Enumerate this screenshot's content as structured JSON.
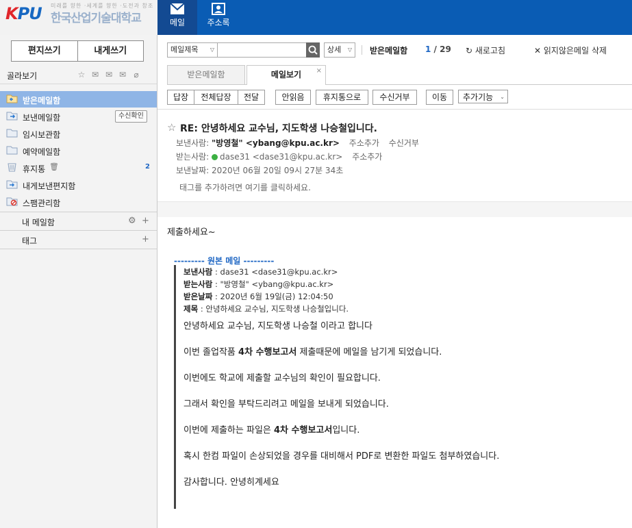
{
  "header": {
    "logo_k": "K",
    "logo_pu": "PU",
    "logo_sub": "미래를 향한 ·세계를 향한 ·도전과 창조",
    "logo_name": "한국산업기술대학교",
    "nav": [
      {
        "label": "메일",
        "icon": "mail-icon"
      },
      {
        "label": "주소록",
        "icon": "contacts-icon"
      }
    ]
  },
  "sidebar": {
    "compose": "편지쓰기",
    "compose_self": "내게쓰기",
    "pick_label": "골라보기",
    "pick_icons": [
      "star-icon",
      "mail-icon",
      "mail-open-icon",
      "mail-me-icon",
      "attach-icon"
    ],
    "folders": [
      {
        "name": "받은메일함",
        "icon": "inbox-folder-icon"
      },
      {
        "name": "보낸메일함",
        "icon": "sent-folder-icon",
        "badge": "수신확인"
      },
      {
        "name": "임시보관함",
        "icon": "draft-folder-icon"
      },
      {
        "name": "예약메일함",
        "icon": "reserved-folder-icon"
      },
      {
        "name": "휴지통",
        "icon": "trash-icon",
        "count": "2"
      },
      {
        "name": "내게보낸편지함",
        "icon": "self-folder-icon"
      },
      {
        "name": "스팸관리함",
        "icon": "spam-folder-icon"
      }
    ],
    "my_mailbox": "내 메일함",
    "tags": "태그"
  },
  "main": {
    "search": {
      "field": "메일제목",
      "detail": "상세"
    },
    "mailbox_title": "받은메일함",
    "page_current": "1",
    "page_sep": " / ",
    "page_total": "29",
    "refresh": "새로고침",
    "delete_unread": "읽지않은메일 삭제",
    "tabs": [
      {
        "label": "받은메일함"
      },
      {
        "label": "메일보기",
        "close": "×"
      }
    ],
    "toolbar": {
      "reply": "답장",
      "reply_all": "전체답장",
      "forward": "전달",
      "mark_unread": "안읽음",
      "to_trash": "휴지통으로",
      "block": "수신거부",
      "move": "이동",
      "more": "추가기능"
    }
  },
  "message": {
    "subject": "RE: 안녕하세요 교수님, 지도학생 나승철입니다.",
    "from_label": "보낸사람:",
    "from_value": "\"방영철\" <ybang@kpu.ac.kr>",
    "add_contact": "주소추가",
    "block": "수신거부",
    "to_label": "받는사람:",
    "to_value": "dase31 <dase31@kpu.ac.kr>",
    "date_label": "보낸날짜:",
    "date_value": "2020년 06월 20일 09시 27분 34초",
    "tag_hint": "태그를 추가하려면 여기를 클릭하세요.",
    "body": "제출하세요~",
    "original": {
      "separator": "--------- 원본 메일 ---------",
      "from_label": "보낸사람",
      "from_value": ": dase31 <dase31@kpu.ac.kr>",
      "to_label": "받는사람",
      "to_value": ": \"방영철\" <ybang@kpu.ac.kr>",
      "date_label": "받은날짜",
      "date_value": ": 2020년 6월 19일(금) 12:04:50",
      "subject_label": "제목",
      "subject_value": ": 안녕하세요 교수님, 지도학생 나승철입니다.",
      "paragraphs": [
        {
          "text": "안녕하세요 교수님, 지도학생 나승철 이라고 합니다"
        },
        {
          "pre": "이번 졸업작품 ",
          "bold": "4차 수행보고서",
          "post": " 제출때문에 메일을 남기게 되었습니다."
        },
        {
          "text": "이번에도 학교에 제출할 교수님의 확인이 필요합니다."
        },
        {
          "text": "그래서 확인을 부탁드리려고 메일을 보내게 되었습니다."
        },
        {
          "pre": "이번에 제출하는 파일은 ",
          "bold": "4차 수행보고서",
          "post": "입니다."
        },
        {
          "text": "혹시 한컴 파일이 손상되었을 경우를 대비해서 PDF로 변환한 파일도 첨부하였습니다."
        },
        {
          "text": "감사합니다. 안녕히계세요"
        }
      ]
    }
  },
  "colors": {
    "topbar": "#0a5cb4",
    "selected_folder": "#8fb5e6",
    "accent": "#1f67c4"
  }
}
